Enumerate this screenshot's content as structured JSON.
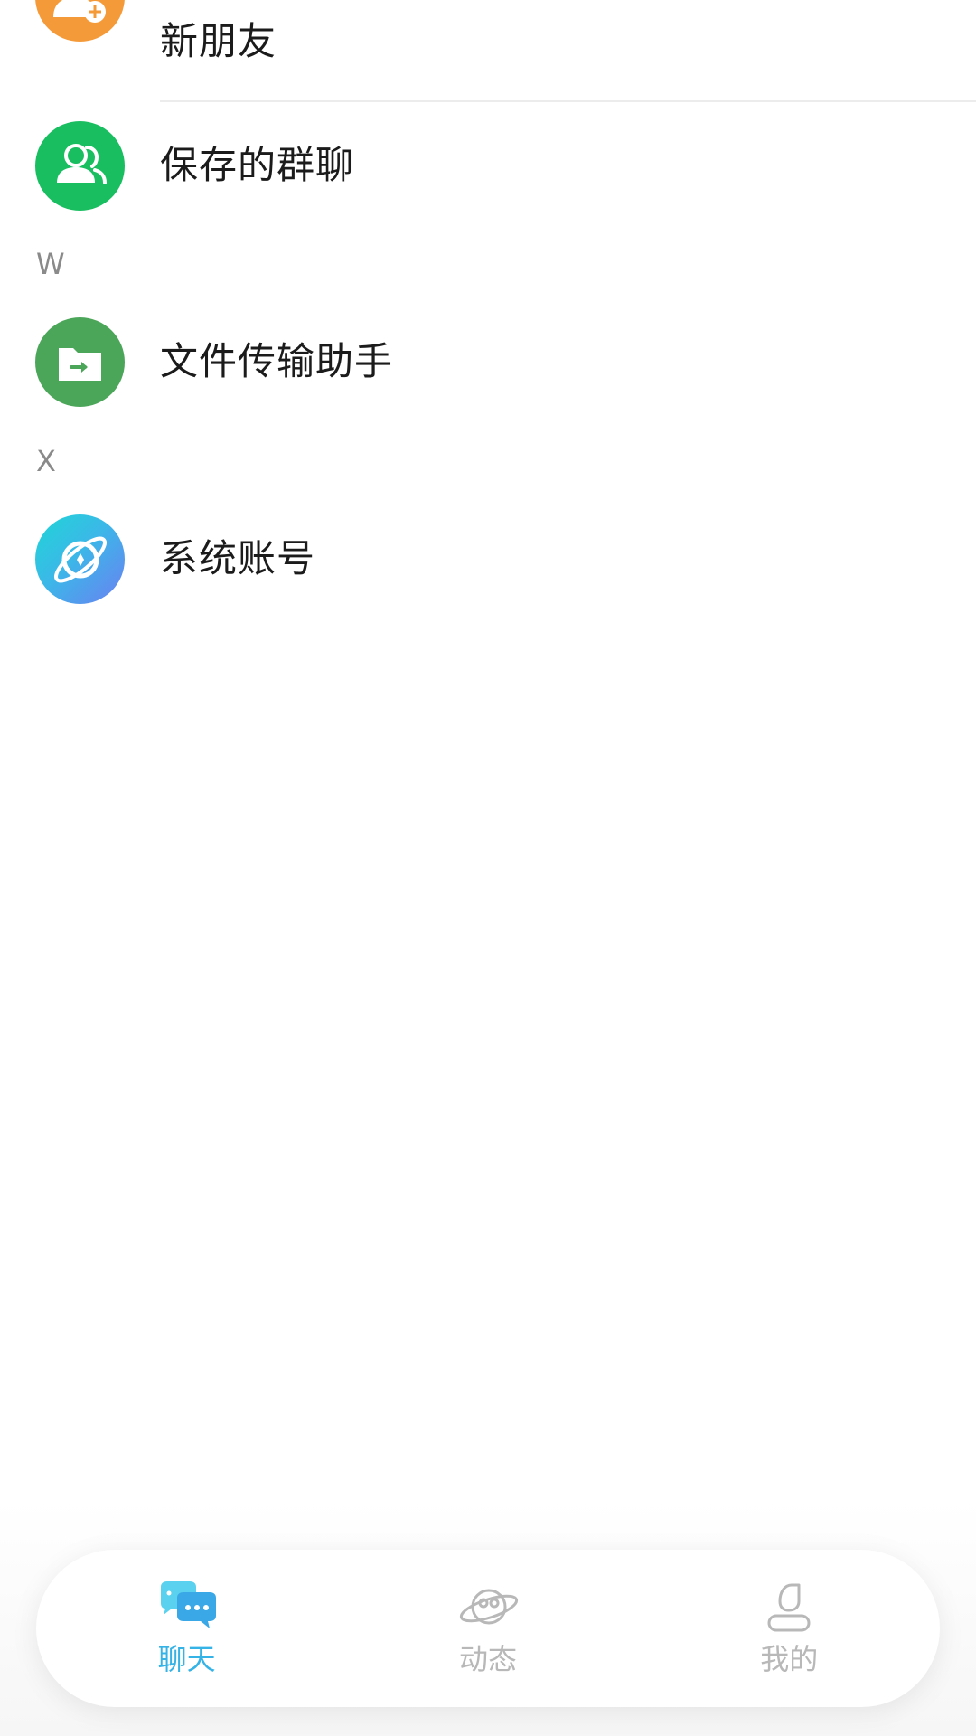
{
  "contacts": {
    "items": [
      {
        "name": "新朋友",
        "icon": "add-friend-icon",
        "color": "#F59A38"
      },
      {
        "name": "保存的群聊",
        "icon": "group-chat-icon",
        "color": "#19BE60"
      },
      {
        "name": "文件传输助手",
        "icon": "file-transfer-icon",
        "color": "#4CA65A"
      },
      {
        "name": "系统账号",
        "icon": "system-account-icon",
        "color": "#3BB8E8"
      }
    ],
    "sections": [
      "W",
      "X"
    ]
  },
  "tabbar": {
    "tabs": [
      {
        "label": "聊天",
        "icon": "chat-bubbles-icon",
        "active": true
      },
      {
        "label": "动态",
        "icon": "planet-icon",
        "active": false
      },
      {
        "label": "我的",
        "icon": "profile-icon",
        "active": false
      }
    ],
    "active_color": "#36B3E6",
    "inactive_color": "#B8B8B8"
  }
}
